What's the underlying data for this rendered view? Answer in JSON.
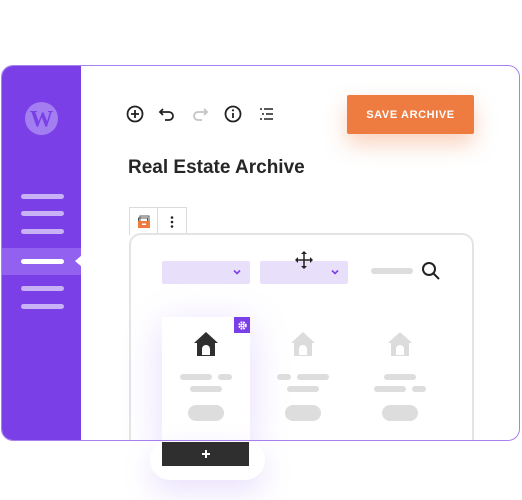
{
  "sidebar": {
    "logo": "wordpress-logo",
    "menu_items": [
      {
        "icon": "menu-line",
        "active": false
      },
      {
        "icon": "menu-line",
        "active": false
      },
      {
        "icon": "menu-line",
        "active": false
      },
      {
        "icon": "menu-line",
        "active": true
      },
      {
        "icon": "menu-line",
        "active": false
      },
      {
        "icon": "menu-line",
        "active": false
      }
    ]
  },
  "toolbar": {
    "icons": [
      "add-block-icon",
      "undo-icon",
      "redo-icon",
      "info-icon",
      "list-view-icon"
    ],
    "save_label": "SAVE ARCHIVE"
  },
  "page": {
    "title": "Real Estate Archive"
  },
  "block_toolbar": {
    "icons": [
      "archive-block-icon",
      "more-options-icon"
    ]
  },
  "filters": {
    "dropdowns": [
      {
        "value": "",
        "icon": "chevron-down-icon"
      },
      {
        "value": "",
        "icon": "chevron-down-icon"
      }
    ],
    "search_icon": "search-icon"
  },
  "cards": [
    {
      "icon": "house-icon",
      "selected": true,
      "settings_icon": "gear-icon"
    },
    {
      "icon": "house-icon",
      "selected": false
    },
    {
      "icon": "house-icon",
      "selected": false
    }
  ],
  "add_button": {
    "label": "+"
  },
  "colors": {
    "brand_purple": "#7b3fe8",
    "accent_orange": "#ee7b40",
    "dropdown_bg": "#e8e0fb",
    "dark": "#2f2f2f"
  }
}
